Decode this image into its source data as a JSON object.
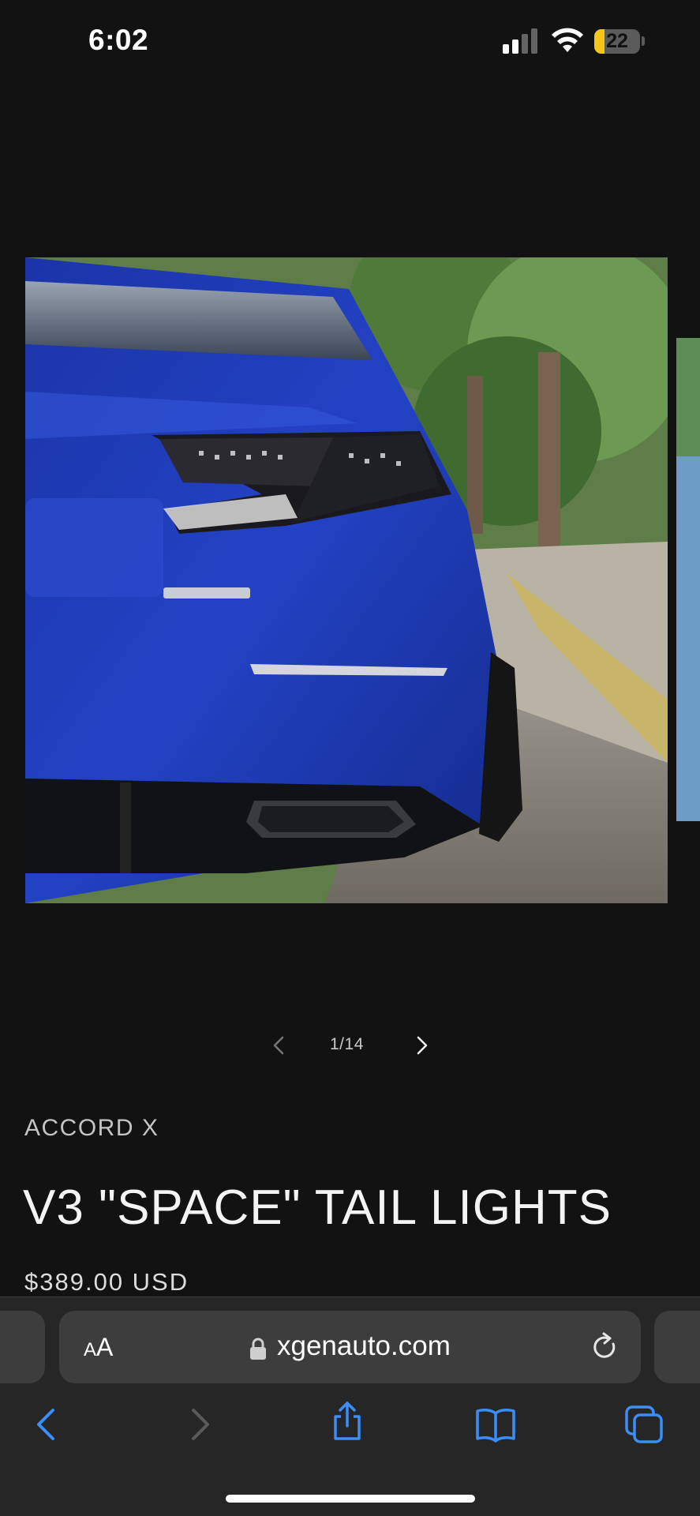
{
  "status_bar": {
    "time": "6:02",
    "battery_level": "22",
    "signal_bars_filled": 2,
    "signal_bars_total": 4,
    "icons": [
      "signal-icon",
      "wifi-icon",
      "battery-icon"
    ]
  },
  "carousel": {
    "counter": "1/14",
    "prev_icon": "chevron-left-icon",
    "next_icon": "chevron-right-icon"
  },
  "product": {
    "vendor": "ACCORD X",
    "title": "V3 \"SPACE\" TAIL LIGHTS",
    "price": "$389.00 USD"
  },
  "browser": {
    "reader_label_small": "A",
    "reader_label_large": "A",
    "url": "xgenauto.com",
    "icons": [
      "lock-icon",
      "reload-icon",
      "back-icon",
      "forward-icon",
      "share-icon",
      "bookmarks-icon",
      "tabs-icon"
    ]
  },
  "colors": {
    "background": "#121212",
    "accent_blue": "#3a8ef6",
    "battery_yellow": "#f5c518"
  }
}
